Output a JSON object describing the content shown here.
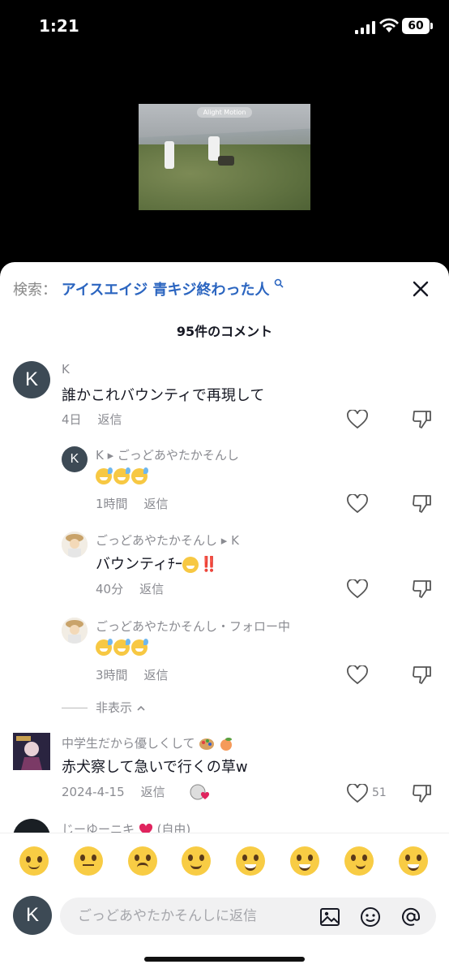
{
  "status_bar": {
    "time": "1:21",
    "battery": "60"
  },
  "video": {
    "watermark": "Alight Motion"
  },
  "header": {
    "search_label": "検索：",
    "search_query": "アイスエイジ 青キジ終わった人",
    "comment_count": "95件のコメント"
  },
  "comments": [
    {
      "username": "K",
      "avatar_letter": "K",
      "text": "誰かこれバウンティで再現して",
      "time": "4日",
      "reply_label": "返信"
    },
    {
      "username": "K ▸ ごっどあやたかそんし",
      "avatar_letter": "K",
      "text": "",
      "time": "1時間",
      "reply_label": "返信",
      "emojis": [
        "sweat-smile",
        "sweat-smile",
        "sweat-smile"
      ]
    },
    {
      "username": "ごっどあやたかそんし ▸ K",
      "text": "バウンティﾁｰ",
      "extra": "‼️",
      "time": "40分",
      "reply_label": "返信",
      "emojis": [
        "nerd-face"
      ]
    },
    {
      "username": "ごっどあやたかそんし・フォロー中",
      "text": "",
      "time": "3時間",
      "reply_label": "返信",
      "emojis": [
        "sweat-smile",
        "sweat-smile",
        "sweat-smile"
      ]
    },
    {
      "username": "中学生だから優しくして",
      "text": "赤犬察して急いで行くの草w",
      "time": "2024-4-15",
      "reply_label": "返信",
      "like_count": "51"
    },
    {
      "username": "じーゆーニキ",
      "suffix": "(自由)"
    }
  ],
  "hide_replies": "非表示",
  "emoji_bar": [
    "pleading-face",
    "flushed-face",
    "crying-face",
    "smiling-face-with-hearts",
    "grinning-face",
    "tears-of-joy",
    "smirking-face",
    "sweat-smile"
  ],
  "reply_input": {
    "avatar_letter": "K",
    "placeholder": "ごっどあやたかそんしに返信"
  }
}
